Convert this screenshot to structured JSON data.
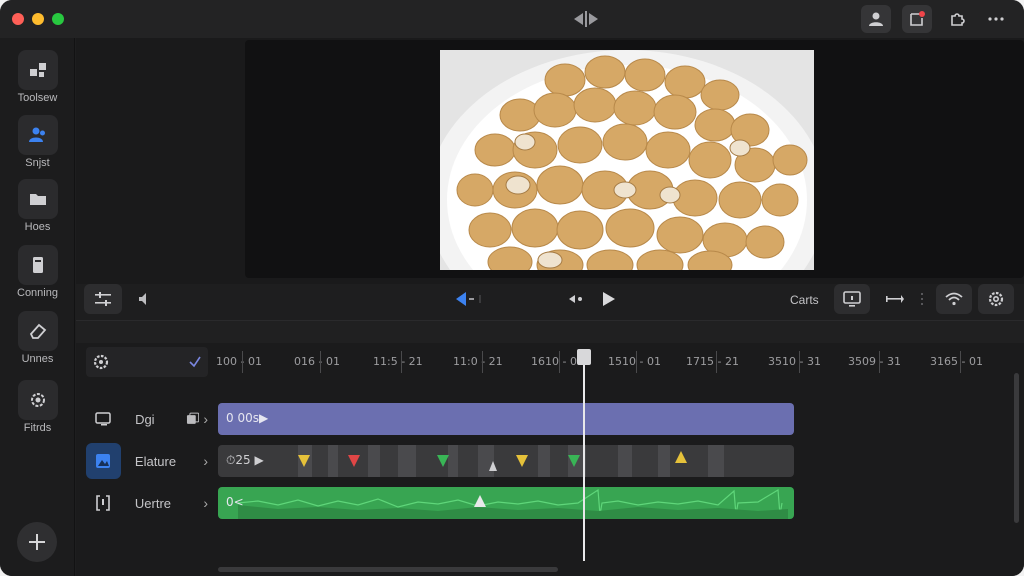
{
  "titlebar": {
    "icons": [
      "split-icon",
      "person-icon",
      "notification-icon",
      "extensions-icon",
      "more-icon"
    ]
  },
  "sidebar": {
    "items": [
      {
        "label": "Toolsew",
        "icon": "blocks-icon"
      },
      {
        "label": "Snjst",
        "icon": "people-icon"
      },
      {
        "label": "Hoes",
        "icon": "folder-icon"
      },
      {
        "label": "Conning",
        "icon": "document-icon"
      },
      {
        "label": "Unnes",
        "icon": "eraser-icon"
      },
      {
        "label": "Fitrds",
        "icon": "settings-icon"
      }
    ]
  },
  "controls": {
    "right_label": "Carts"
  },
  "ruler": {
    "ticks": [
      "100 - 01",
      "016 - 01",
      "11:5 - 21",
      "11:0 - 21",
      "1610 - 01",
      "1510 - 01",
      "1715 - 21",
      "3510 - 31",
      "3509 - 31",
      "3165 - 01"
    ]
  },
  "tracks": [
    {
      "label": "Dgi",
      "clip_text": "0 00s▶"
    },
    {
      "label": "Elature",
      "clip_text": "⏱25 ▶"
    },
    {
      "label": "Uertre",
      "clip_text": "0<"
    }
  ],
  "colors": {
    "accent_blue": "#3c82f0",
    "clip_purple": "#6b6fb0",
    "clip_green": "#38a552",
    "marker_yellow": "#e5c13a",
    "marker_red": "#e04646",
    "marker_green": "#39b556"
  }
}
